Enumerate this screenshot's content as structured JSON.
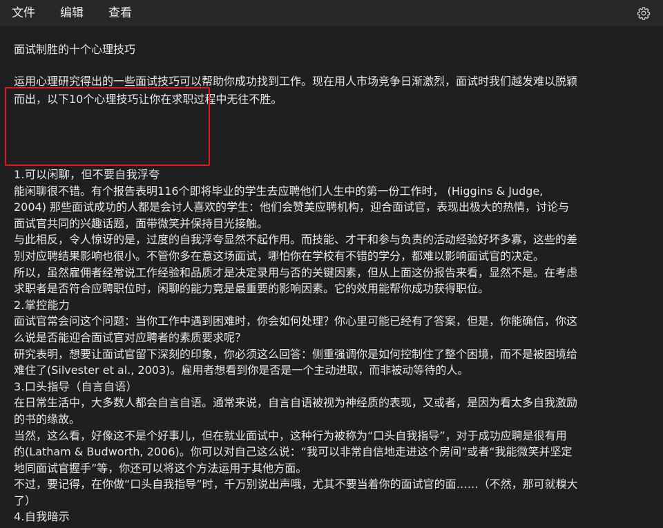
{
  "menubar": {
    "items": [
      "文件",
      "编辑",
      "查看"
    ],
    "settings_icon": "gear-icon"
  },
  "document": {
    "title": "面试制胜的十个心理技巧",
    "intro_lines": [
      "运用心理研究得出的一些面试技巧可以帮助你成功找到工作。现在用人市场竞争日渐激烈，面试时我们越发难以脱颖",
      "而出，以下10个心理技巧让你在求职过程中无往不胜。"
    ],
    "body_lines": [
      "1.可以闲聊，但不要自我浮夸",
      "能闲聊很不错。有个报告表明116个即将毕业的学生去应聘他们人生中的第一份工作时， (Higgins & Judge,",
      "2004) 那些面试成功的人都是会讨人喜欢的学生：他们会赞美应聘机构，迎合面试官，表现出极大的热情，讨论与",
      "面试官共同的兴趣话题，面带微笑并保持目光接触。",
      "与此相反，令人惊讶的是，过度的自我浮夸显然不起作用。而技能、才干和参与负责的活动经验好坏多寡，这些的差",
      "别对应聘结果影响也很小。不管你多在意这场面试，哪怕你在学校有不错的学分，都难以影响面试官的决定。",
      "所以，虽然雇佣者经常说工作经验和品质才是决定录用与否的关键因素，但从上面这份报告来看，显然不是。在考虑",
      "求职者是否符合应聘职位时，闲聊的能力竟是最重要的影响因素。它的效用能帮你成功获得职位。",
      "2.掌控能力",
      "面试官常会问这个问题：当你工作中遇到困难时，你会如何处理？你心里可能已经有了答案，但是，你能确信，你这",
      "么说是否能迎合面试官对应聘者的素质要求呢？",
      "研究表明，想要让面试官留下深刻的印象，你必须这么回答：侧重强调你是如何控制住了整个困境，而不是被困境给",
      "难住了(Silvester et al., 2003)。雇用者想看到你是否是一个主动进取，而非被动等待的人。",
      "3.口头指导（自言自语）",
      "在日常生活中，大多数人都会自言自语。通常来说，自言自语被视为神经质的表现，又或者，是因为看太多自我激励",
      "的书的缘故。",
      "当然，这么看，好像这不是个好事儿，但在就业面试中，这种行为被称为“口头自我指导”，对于成功应聘是很有用",
      "的(Latham & Budworth, 2006)。你可以对自己这么说：“我可以非常自信地走进这个房间”或者“我能微笑并坚定",
      "地同面试官握手”等，你还可以将这个方法运用于其他方面。",
      "不过，要记得，在你做“口头自我指导”时，千万别说出声哦，尤其不要当着你的面试官的面……（不然，那可就糗大",
      "了）",
      "4.自我暗示"
    ]
  },
  "annotation": {
    "color": "#e0191f"
  }
}
